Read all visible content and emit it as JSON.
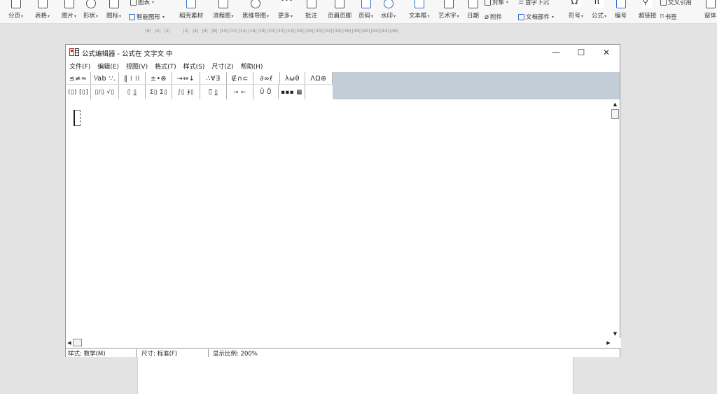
{
  "ribbon": {
    "groups": [
      {
        "label": "分页",
        "icon": "page-break-icon",
        "dropdown": true
      },
      {
        "label": "表格",
        "icon": "table-icon",
        "dropdown": true
      },
      {
        "label": "图片",
        "icon": "picture-icon",
        "dropdown": true
      },
      {
        "label": "形状",
        "icon": "shape-icon",
        "dropdown": true
      },
      {
        "label": "图标",
        "icon": "icon-library-icon",
        "dropdown": true
      },
      {
        "label": "智能图形",
        "icon": "smart-graphic-icon",
        "dropdown": false
      },
      {
        "label": "稻壳素材",
        "icon": "docer-material-icon",
        "dropdown": false
      },
      {
        "label": "流程图",
        "icon": "flowchart-icon",
        "dropdown": true
      },
      {
        "label": "思维导图",
        "icon": "mindmap-icon",
        "dropdown": true
      },
      {
        "label": "更多",
        "icon": "more-icon",
        "dropdown": true
      },
      {
        "label": "批注",
        "icon": "comment-icon",
        "dropdown": false
      },
      {
        "label": "页眉页脚",
        "icon": "header-footer-icon",
        "dropdown": false
      },
      {
        "label": "页码",
        "icon": "page-number-icon",
        "dropdown": true
      },
      {
        "label": "水印",
        "icon": "watermark-icon",
        "dropdown": true
      },
      {
        "label": "文本框",
        "icon": "textbox-icon",
        "dropdown": true
      },
      {
        "label": "艺术字",
        "icon": "wordart-icon",
        "dropdown": true
      },
      {
        "label": "日期",
        "icon": "date-icon",
        "dropdown": false
      },
      {
        "label": "附件",
        "icon": "attachment-icon",
        "dropdown": false
      },
      {
        "label": "文档部件",
        "icon": "doc-parts-icon",
        "dropdown": true
      },
      {
        "label": "符号",
        "icon": "symbol-icon",
        "dropdown": true
      },
      {
        "label": "公式",
        "icon": "formula-icon",
        "dropdown": true
      },
      {
        "label": "编号",
        "icon": "numbering-icon",
        "dropdown": false
      },
      {
        "label": "超链接",
        "icon": "hyperlink-icon",
        "dropdown": false
      },
      {
        "label": "书签",
        "icon": "bookmark-icon",
        "dropdown": false
      },
      {
        "label": "窗体",
        "icon": "form-icon",
        "dropdown": false
      }
    ],
    "top_labels": {
      "chart": "图表",
      "object": "对象",
      "drop_cap": "首字下沉",
      "cross_ref": "交叉引用"
    }
  },
  "ruler": {
    "ticks": [
      "6",
      "4",
      "2",
      "",
      "2",
      "4",
      "6",
      "8",
      "10",
      "12",
      "14",
      "16",
      "18",
      "20",
      "22",
      "24",
      "26",
      "28",
      "30",
      "32",
      "34",
      "36",
      "38",
      "40",
      "42",
      "44",
      "46"
    ]
  },
  "editor": {
    "title": "公式编辑器 - 公式在 文字文 中",
    "window_buttons": {
      "minimize": "—",
      "maximize": "☐",
      "close": "✕"
    },
    "menu": [
      "文件(F)",
      "编辑(E)",
      "视图(V)",
      "格式(T)",
      "样式(S)",
      "尺寸(Z)",
      "帮助(H)"
    ],
    "toolbar_row1": [
      "≤≠≈",
      "⅟ab ∵.",
      "‖ ⁞ ⁞⁞",
      "±•⊗",
      "→⇔↓",
      "∴∀∃",
      "∉∩⊂",
      "∂∞ℓ",
      "λωθ",
      "ΛΩ⊛"
    ],
    "toolbar_row2": [
      "(▯) [▯]",
      "▯/▯ √▯",
      "▯̇ ▯̲",
      "Σ▯ Σ▯",
      "∫▯ ∮▯",
      "▯̅ ▯̲",
      "→ ←",
      "Ũ Ů",
      "▪▪▪ ▦"
    ],
    "status": {
      "style": "样式: 数学(M)",
      "size": "尺寸: 标准(F)",
      "zoom": "显示比例: 200%"
    }
  }
}
